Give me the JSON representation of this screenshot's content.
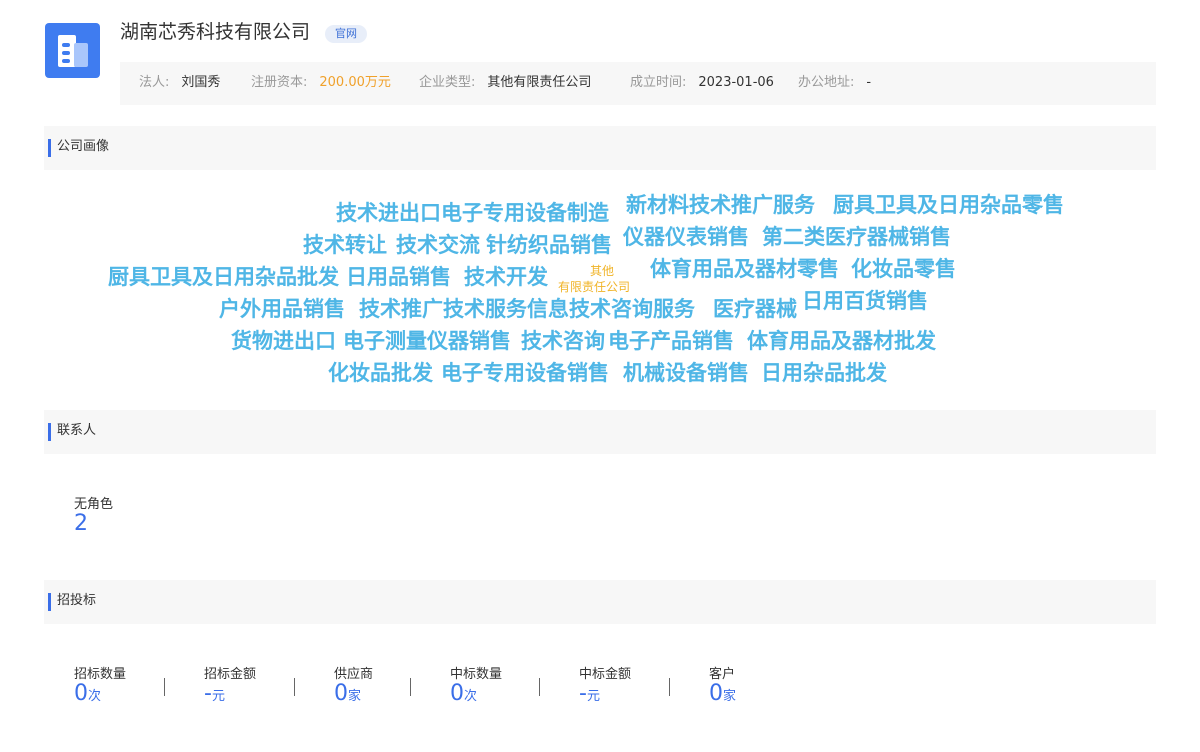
{
  "company": {
    "name": "湖南芯秀科技有限公司",
    "badge": "官网"
  },
  "info": {
    "legal_person_label": "法人:",
    "legal_person": "刘国秀",
    "capital_label": "注册资本:",
    "capital": "200.00万元",
    "type_label": "企业类型:",
    "type": "其他有限责任公司",
    "founded_label": "成立时间:",
    "founded": "2023-01-06",
    "address_label": "办公地址:",
    "address": "-"
  },
  "sections": {
    "profile": "公司画像",
    "contacts": "联系人",
    "bidding": "招投标"
  },
  "word_cloud": {
    "words": [
      "技术进出口",
      "电子专用设备制造",
      "新材料技术推广服务",
      "厨具卫具及日用杂品零售",
      "技术转让",
      "技术交流",
      "针纺织品销售",
      "仪器仪表销售",
      "第二类医疗器械销售",
      "厨具卫具及日用杂品批发",
      "日用品销售",
      "技术开发",
      "其他",
      "有限责任公司",
      "体育用品及器材零售",
      "化妆品零售",
      "户外用品销售",
      "技术推广",
      "技术服务",
      "信息技术咨询服务",
      "医疗器械",
      "日用百货销售",
      "货物进出口",
      "电子测量仪器销售",
      "技术咨询",
      "电子产品销售",
      "体育用品及器材批发",
      "化妆品批发",
      "电子专用设备销售",
      "机械设备销售",
      "日用杂品批发"
    ],
    "colors": {
      "main": "#4fb6e6",
      "accent": "#f0b429"
    }
  },
  "contacts": {
    "role_label": "无角色",
    "role_count": "2"
  },
  "bidding": {
    "stats": [
      {
        "label": "招标数量",
        "value": "0",
        "unit": "次"
      },
      {
        "label": "招标金额",
        "value": "-",
        "unit": "元"
      },
      {
        "label": "供应商",
        "value": "0",
        "unit": "家"
      },
      {
        "label": "中标数量",
        "value": "0",
        "unit": "次"
      },
      {
        "label": "中标金额",
        "value": "-",
        "unit": "元"
      },
      {
        "label": "客户",
        "value": "0",
        "unit": "家"
      }
    ]
  },
  "colors": {
    "accent": "#3a6ee8",
    "logo": "#3f7cf0",
    "money": "#f0a12b"
  }
}
